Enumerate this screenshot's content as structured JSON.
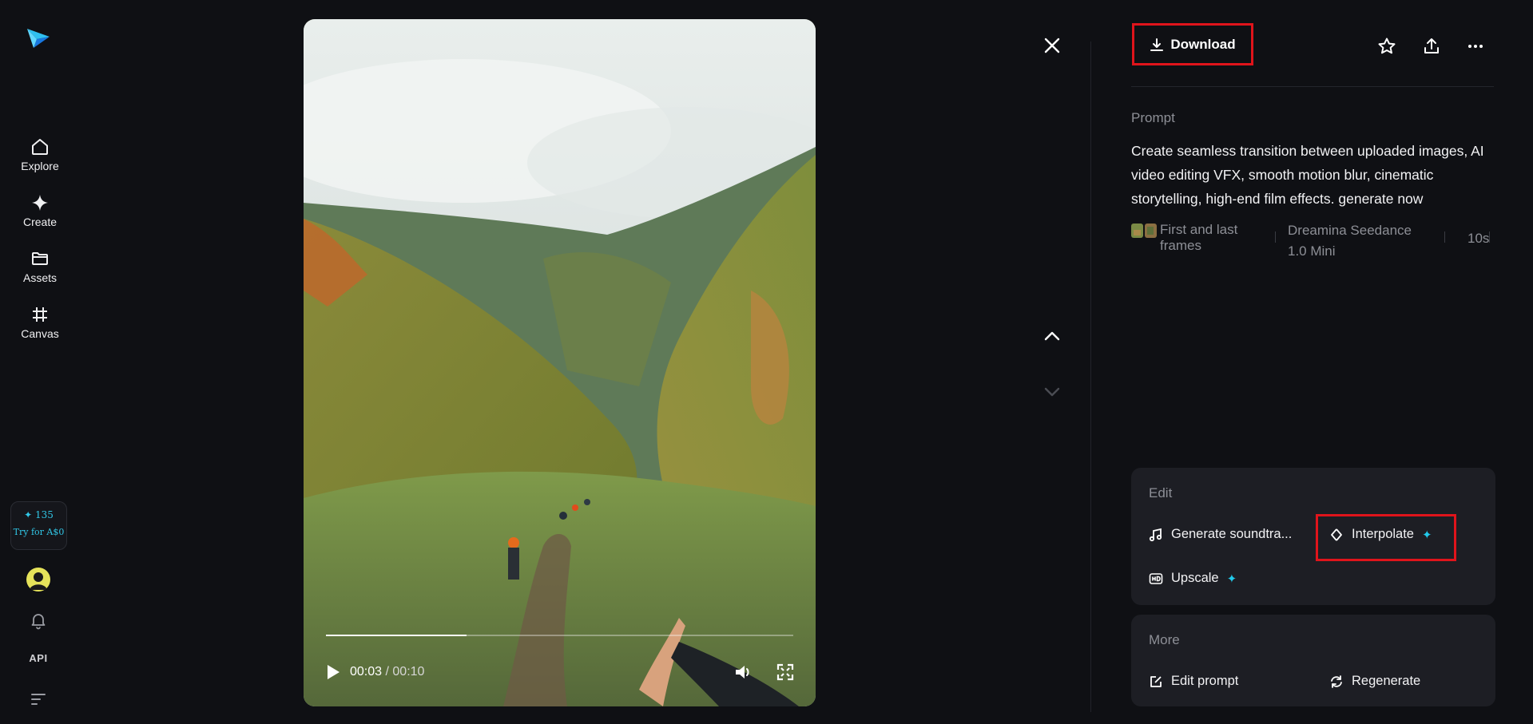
{
  "sidebar": {
    "items": [
      {
        "label": "Explore",
        "icon": "home-icon"
      },
      {
        "label": "Create",
        "icon": "sparkle-icon"
      },
      {
        "label": "Assets",
        "icon": "folder-icon"
      },
      {
        "label": "Canvas",
        "icon": "canvas-icon"
      }
    ],
    "credits": {
      "count": "✦ 135",
      "try_label": "Try for A$0"
    },
    "api_label": "API"
  },
  "player": {
    "current_time": "00:03",
    "separator": " / ",
    "total_time": "00:10",
    "progress": 0.3
  },
  "toolbar": {
    "download_label": "Download"
  },
  "prompt": {
    "label": "Prompt",
    "text": "Create seamless transition between uploaded images, AI video editing VFX, smooth motion blur, cinematic storytelling, high-end film effects. generate now"
  },
  "meta": {
    "type": "First and last frames",
    "model": "Dreamina Seedance 1.0 Mini",
    "duration": "10s"
  },
  "edit": {
    "title": "Edit",
    "generate_soundtrack": "Generate soundtra...",
    "interpolate": "Interpolate",
    "upscale": "Upscale"
  },
  "more": {
    "title": "More",
    "edit_prompt": "Edit prompt",
    "regenerate": "Regenerate"
  },
  "colors": {
    "accent": "#22c9ea",
    "highlight": "#e0141b",
    "background": "#0f1014",
    "card": "#1d1e24"
  }
}
